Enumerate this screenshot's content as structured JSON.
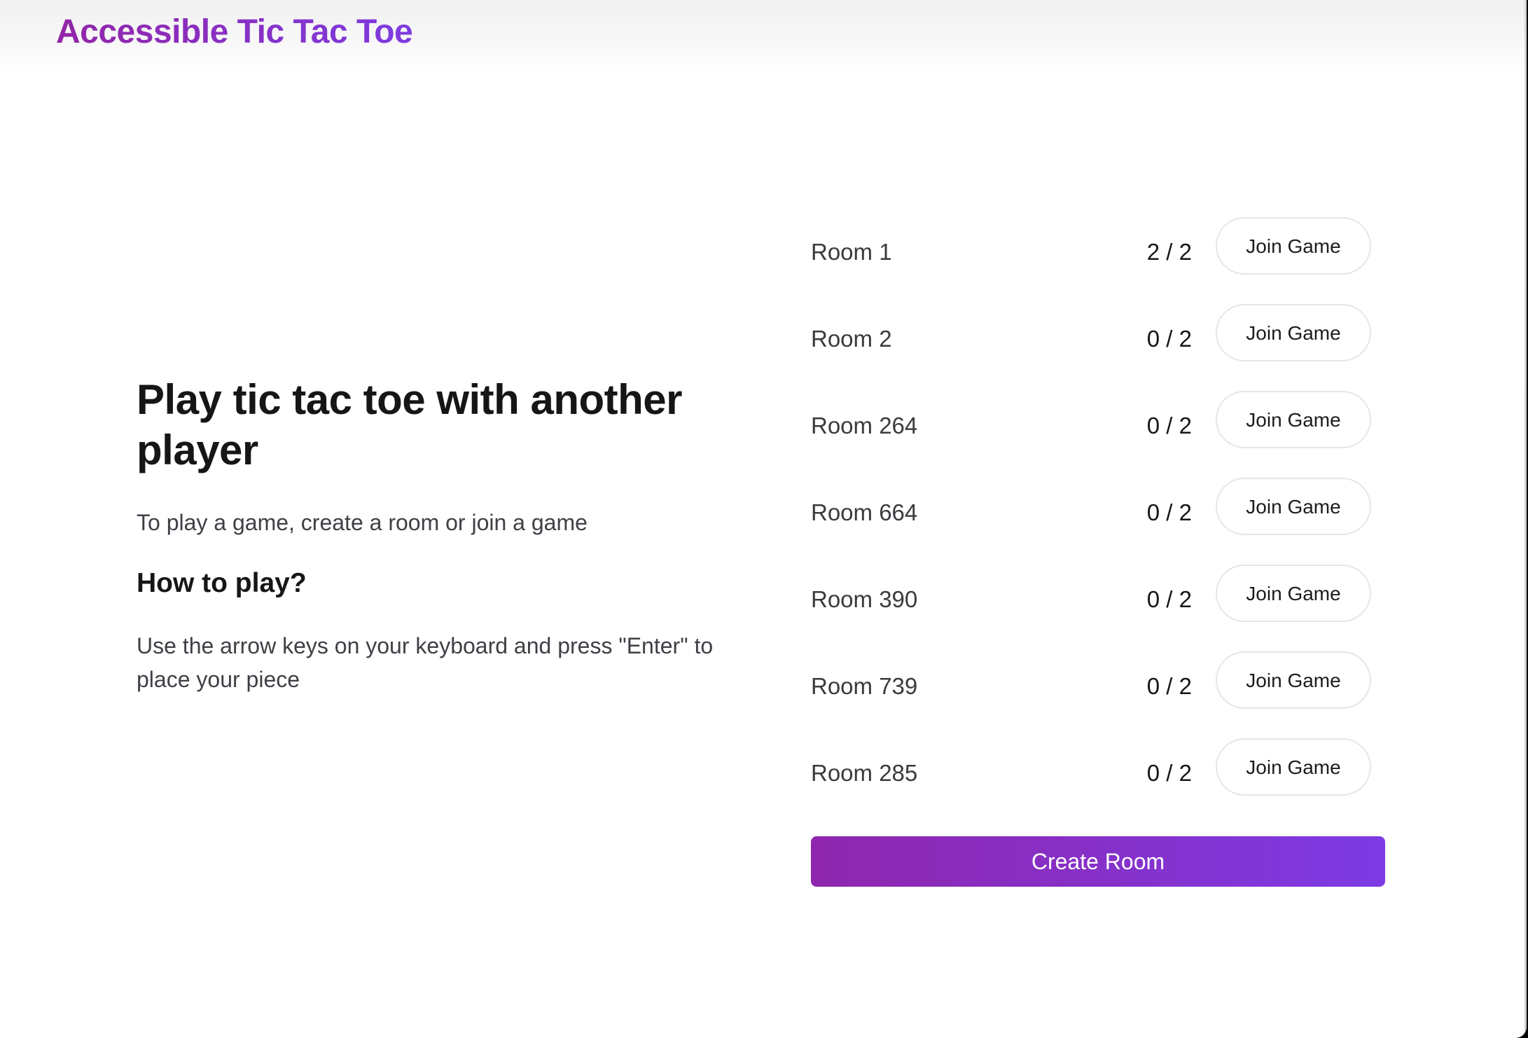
{
  "app": {
    "title": "Accessible Tic Tac Toe"
  },
  "intro": {
    "heading": "Play tic tac toe with another player",
    "lead": "To play a game, create a room or join a game",
    "howto_heading": "How to play?",
    "howto_text": "Use the arrow keys on your keyboard and press \"Enter\" to place your piece"
  },
  "rooms": [
    {
      "name": "Room 1",
      "count": "2 / 2",
      "button": "Join Game"
    },
    {
      "name": "Room 2",
      "count": "0 / 2",
      "button": "Join Game"
    },
    {
      "name": "Room 264",
      "count": "0 / 2",
      "button": "Join Game"
    },
    {
      "name": "Room 664",
      "count": "0 / 2",
      "button": "Join Game"
    },
    {
      "name": "Room 390",
      "count": "0 / 2",
      "button": "Join Game"
    },
    {
      "name": "Room 739",
      "count": "0 / 2",
      "button": "Join Game"
    },
    {
      "name": "Room 285",
      "count": "0 / 2",
      "button": "Join Game"
    }
  ],
  "actions": {
    "create_room": "Create Room"
  },
  "colors": {
    "brand_start": "#9225a8",
    "brand_end": "#7e3be0"
  }
}
